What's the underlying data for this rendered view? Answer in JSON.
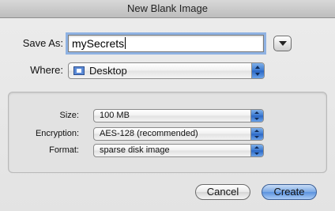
{
  "window": {
    "title": "New Blank Image"
  },
  "save_as": {
    "label": "Save As:",
    "value": "mySecrets"
  },
  "where": {
    "label": "Where:",
    "value": "Desktop"
  },
  "options": {
    "size": {
      "label": "Size:",
      "value": "100 MB"
    },
    "encryption": {
      "label": "Encryption:",
      "value": "AES-128 (recommended)"
    },
    "format": {
      "label": "Format:",
      "value": "sparse disk image"
    }
  },
  "buttons": {
    "cancel": "Cancel",
    "create": "Create"
  },
  "icons": {
    "location": "desktop-folder-icon",
    "disclosure": "disclosure-triangle-icon"
  },
  "colors": {
    "accent": "#3a78d0",
    "focus_ring": "#8fb2e2"
  }
}
